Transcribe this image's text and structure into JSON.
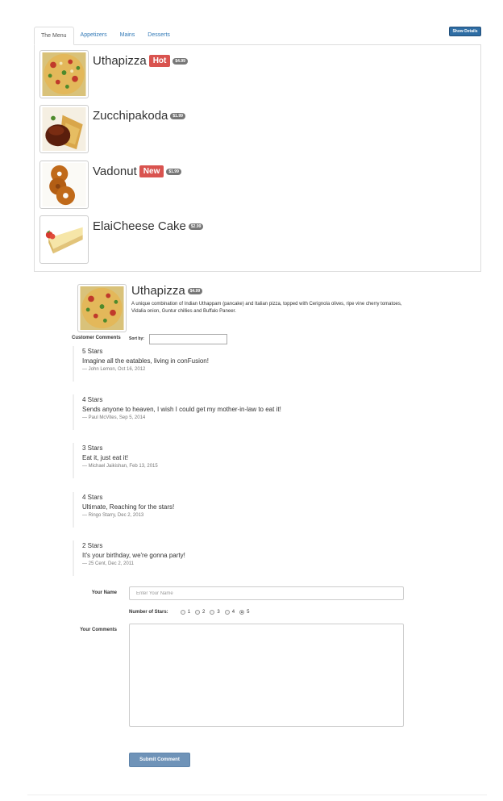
{
  "tabs": [
    {
      "label": "The Menu",
      "active": true
    },
    {
      "label": "Appetizers"
    },
    {
      "label": "Mains"
    },
    {
      "label": "Desserts"
    }
  ],
  "details_button": "Show Details",
  "menu_items": [
    {
      "name": "Uthapizza",
      "label": "Hot",
      "price": "$4.99",
      "image": "pizza-image"
    },
    {
      "name": "Zucchipakoda",
      "label": "",
      "price": "$1.99",
      "image": "pakoda-image"
    },
    {
      "name": "Vadonut",
      "label": "New",
      "price": "$1.99",
      "image": "donut-image"
    },
    {
      "name": "ElaiCheese Cake",
      "label": "",
      "price": "$2.99",
      "image": "cheesecake-image"
    }
  ],
  "detail": {
    "name": "Uthapizza",
    "price": "$4.99",
    "description": "A unique combination of Indian Uthappam (pancake) and Italian pizza, topped with Cerignola olives, ripe vine cherry tomatoes, Vidalia onion, Guntur chillies and Buffalo Paneer."
  },
  "comments_section": {
    "title": "Customer Comments",
    "sort_label": "Sort by:",
    "sort_value": ""
  },
  "comments": [
    {
      "stars": "5 Stars",
      "text": "Imagine all the eatables, living in conFusion!",
      "author": "— John Lemon, Oct 16, 2012"
    },
    {
      "stars": "4 Stars",
      "text": "Sends anyone to heaven, I wish I could get my mother-in-law to eat it!",
      "author": "— Paul McVites, Sep 5, 2014"
    },
    {
      "stars": "3 Stars",
      "text": "Eat it, just eat it!",
      "author": "— Michael Jaikishan, Feb 13, 2015"
    },
    {
      "stars": "4 Stars",
      "text": "Ultimate, Reaching for the stars!",
      "author": "— Ringo Starry, Dec 2, 2013"
    },
    {
      "stars": "2 Stars",
      "text": "It's your birthday, we're gonna party!",
      "author": "— 25 Cent, Dec 2, 2011"
    }
  ],
  "form": {
    "name_label": "Your Name",
    "name_placeholder": "Enter Your Name",
    "stars_label": "Number of Stars:",
    "star_options": [
      "1",
      "2",
      "3",
      "4",
      "5"
    ],
    "selected_star": "5",
    "comments_label": "Your Comments",
    "submit_label": "Submit Comment"
  },
  "colors": {
    "accent": "#337ab7",
    "danger": "#d9534f",
    "badge": "#777777"
  }
}
